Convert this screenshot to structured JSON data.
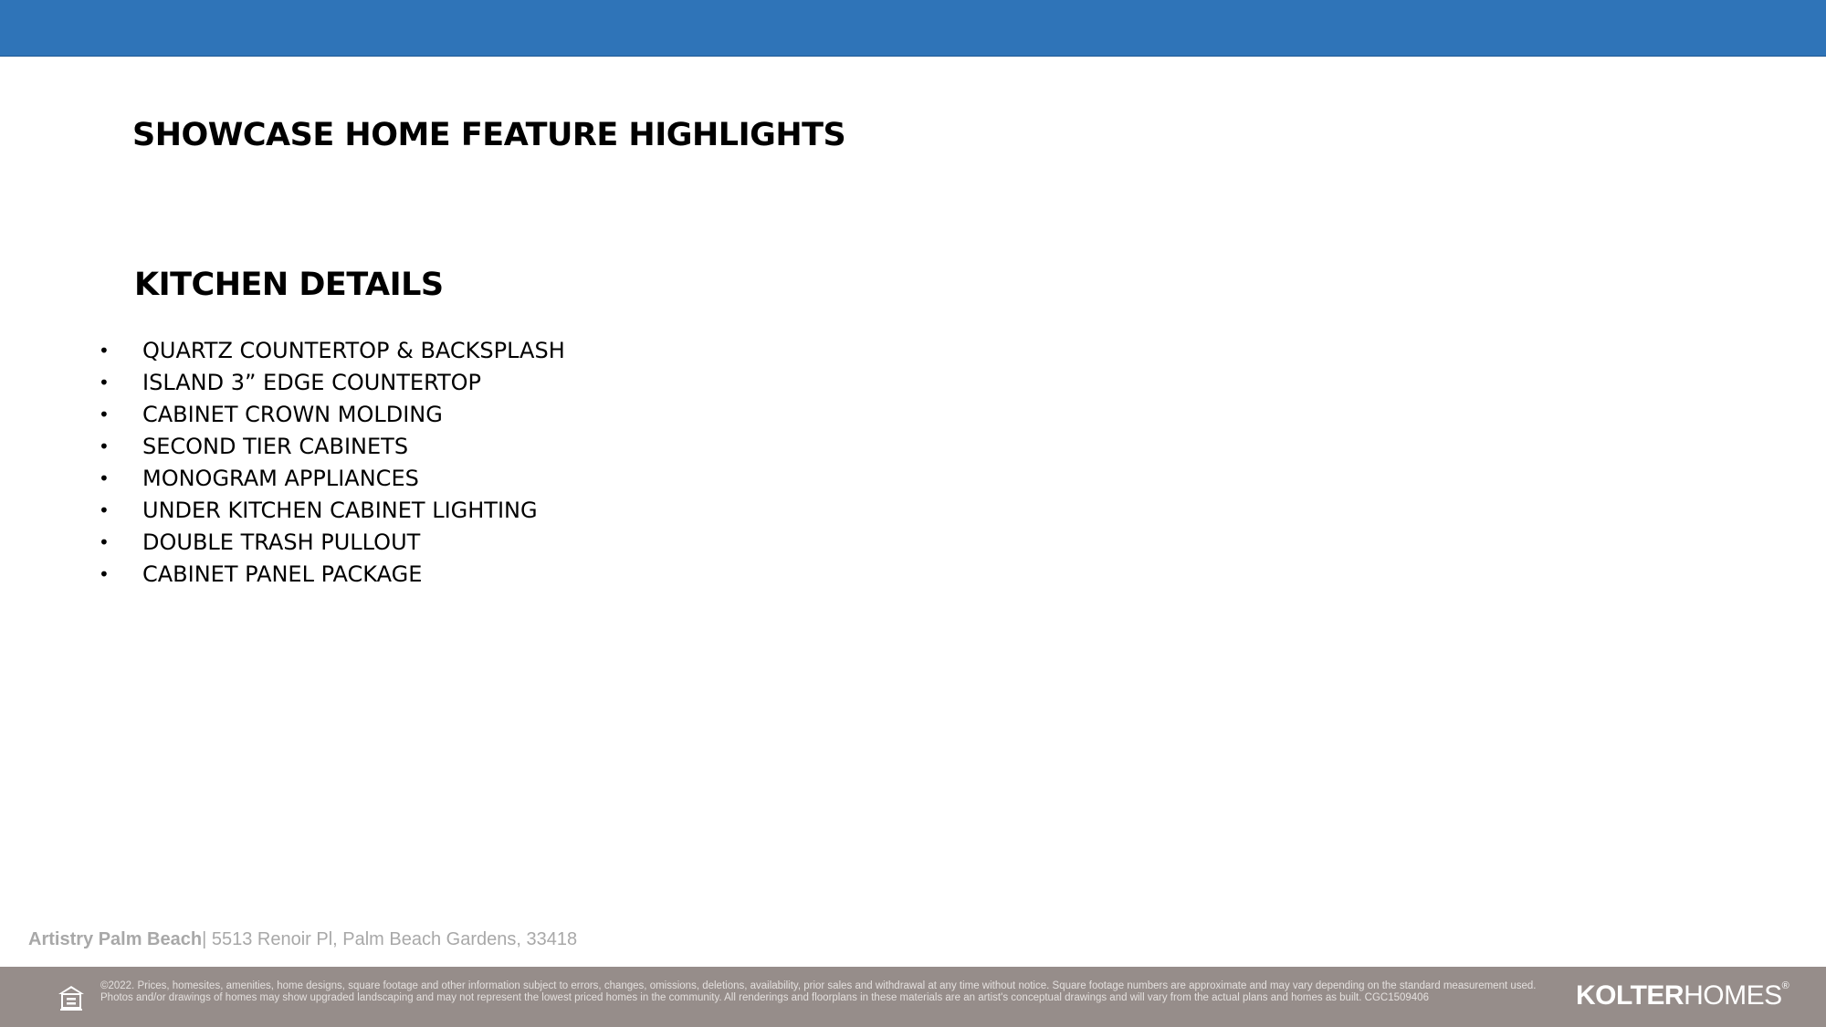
{
  "slide": {
    "title": "SHOWCASE HOME FEATURE HIGHLIGHTS",
    "section_title": "KITCHEN DETAILS",
    "bullet_glyph": "•",
    "features": [
      "QUARTZ COUNTERTOP & BACKSPLASH",
      "ISLAND 3” EDGE COUNTERTOP",
      "CABINET CROWN MOLDING",
      "SECOND TIER CABINETS",
      "MONOGRAM APPLIANCES",
      "UNDER KITCHEN CABINET LIGHTING",
      "DOUBLE TRASH PULLOUT",
      "CABINET PANEL PACKAGE"
    ]
  },
  "footer": {
    "community": "Artistry Palm Beach",
    "address": "| 5513 Renoir Pl, Palm Beach Gardens, 33418",
    "disclaimer": "©2022. Prices, homesites, amenities, home designs, square footage and other information subject to errors, changes, omissions, deletions, availability, prior sales and withdrawal at any time without notice. Square footage numbers are approximate and may vary depending on the standard measurement used. Photos and/or drawings of homes may show upgraded landscaping and may not represent the lowest priced homes in the community. All renderings and floorplans in these materials are an artist's conceptual drawings and will vary from the actual plans and homes as built. CGC1509406",
    "brand_bold": "KOLTER",
    "brand_light": "HOMES",
    "brand_mark": "®",
    "housing_icon": "equal-housing-opportunity-icon"
  },
  "colors": {
    "top_bar": "#2f74b8",
    "footer_bar": "#968d8a",
    "address_text": "#a8a8a8"
  }
}
